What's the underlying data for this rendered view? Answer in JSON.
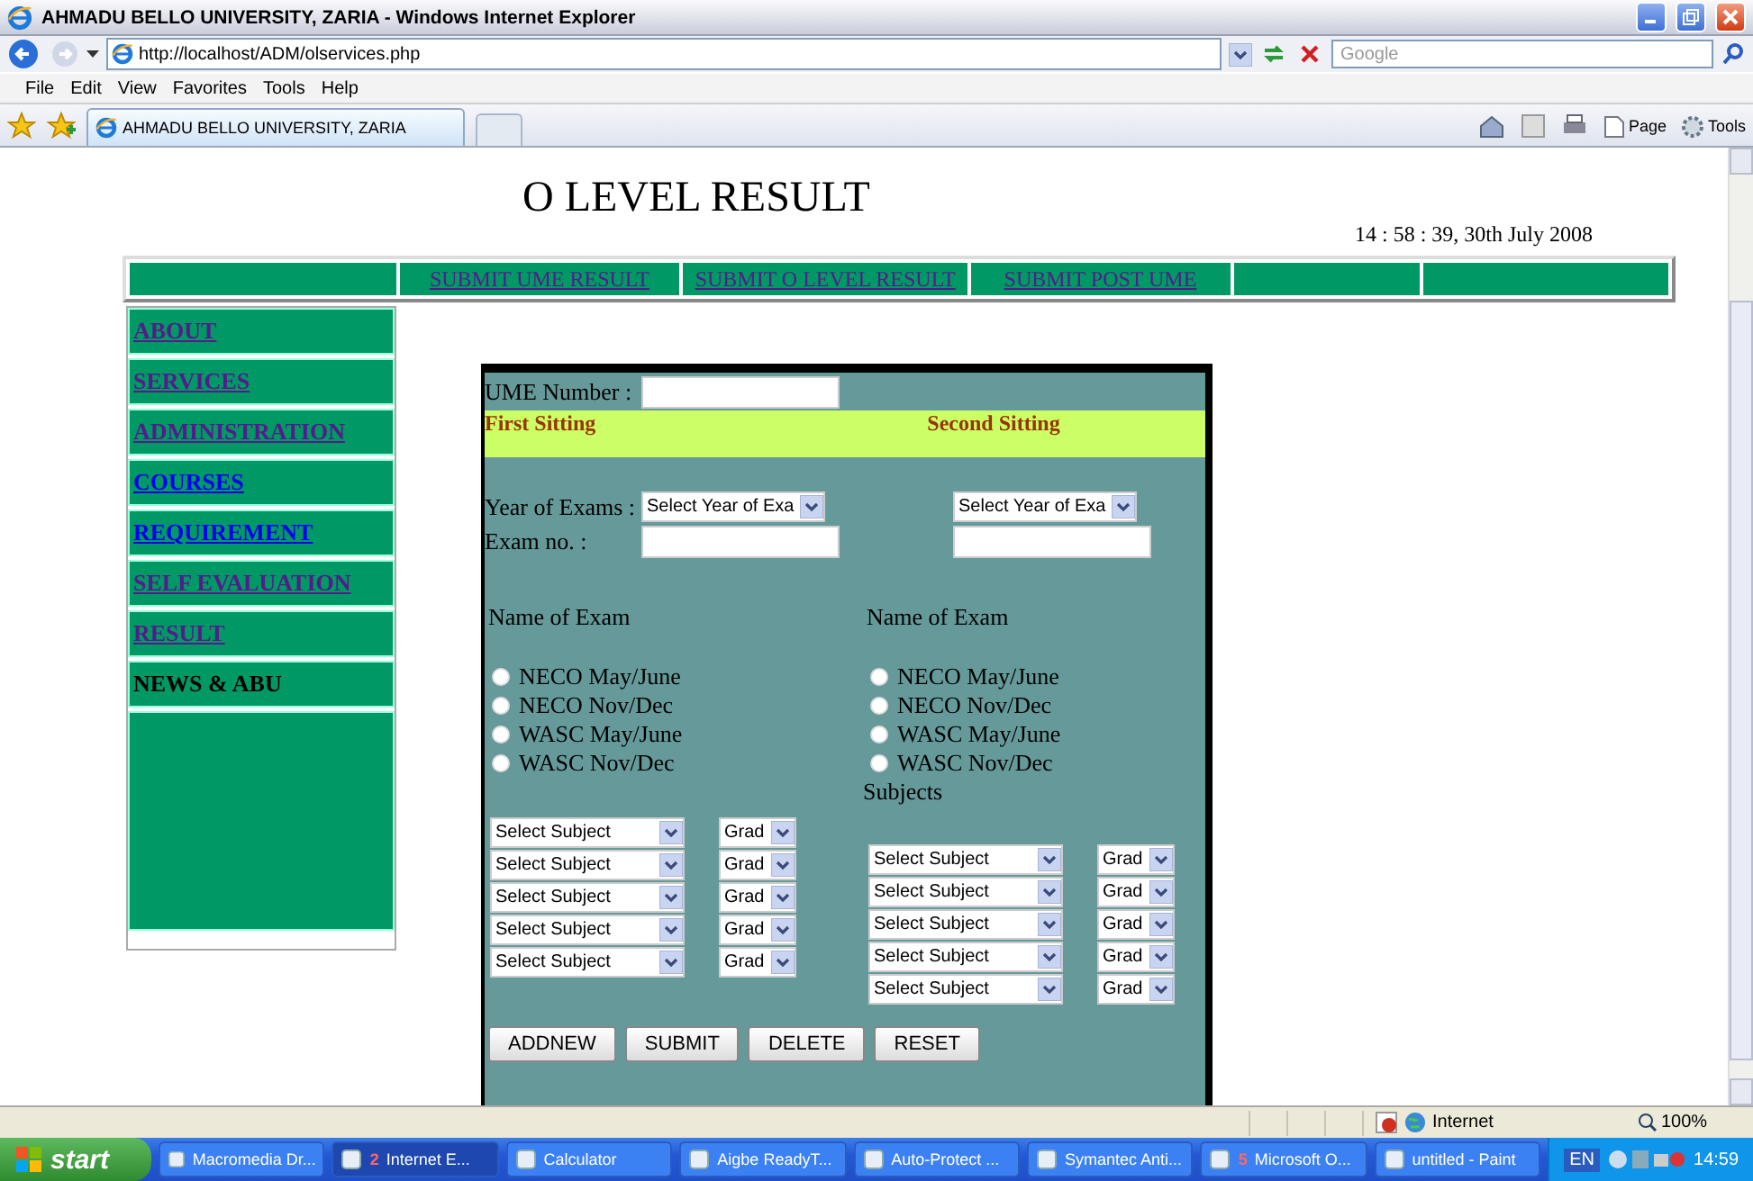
{
  "browser": {
    "title": "AHMADU BELLO UNIVERSITY, ZARIA - Windows Internet Explorer",
    "address": "http://localhost/ADM/olservices.php",
    "search_placeholder": "Google",
    "menu": [
      "File",
      "Edit",
      "View",
      "Favorites",
      "Tools",
      "Help"
    ],
    "tab": "AHMADU BELLO UNIVERSITY, ZARIA",
    "tools": [
      "Page",
      "Tools"
    ]
  },
  "page": {
    "heading": "O LEVEL RESULT",
    "datetime": "14 : 58 : 39, 30th July 2008",
    "nav": [
      {
        "kind": "blank"
      },
      {
        "kind": "link",
        "label": "SUBMIT UME RESULT"
      },
      {
        "kind": "link",
        "label": "SUBMIT O LEVEL RESULT"
      },
      {
        "kind": "link",
        "label": "SUBMIT POST UME"
      },
      {
        "kind": "blank"
      },
      {
        "kind": "blank"
      }
    ],
    "sidebar": [
      {
        "label": "ABOUT",
        "kind": "visited"
      },
      {
        "label": "SERVICES",
        "kind": "visited"
      },
      {
        "label": "ADMINISTRATION",
        "kind": "visited"
      },
      {
        "label": "COURSES",
        "kind": "link"
      },
      {
        "label": "REQUIREMENT",
        "kind": "link"
      },
      {
        "label": "SELF EVALUATION",
        "kind": "visited"
      },
      {
        "label": "RESULT",
        "kind": "visited"
      },
      {
        "label": "NEWS & ABU",
        "kind": "text"
      }
    ]
  },
  "form": {
    "ume_label": "UME Number :",
    "headers": [
      "First Sitting",
      "Second Sitting"
    ],
    "year_label": "Year of Exams :",
    "exam_no_label": "Exam no. :",
    "sittings": [
      {
        "year_select": "Select Year of Exa",
        "name_label": "Name of Exam",
        "exams": [
          {
            "label": "NECO May/June",
            "selected": false
          },
          {
            "label": "NECO Nov/Dec",
            "selected": false
          },
          {
            "label": "WASC May/June",
            "selected": false
          },
          {
            "label": "WASC Nov/Dec",
            "selected": false
          }
        ],
        "subjects": [
          {
            "subject": "Select Subject",
            "grade": "Grad"
          },
          {
            "subject": "Select Subject",
            "grade": "Grad"
          },
          {
            "subject": "Select Subject",
            "grade": "Grad"
          },
          {
            "subject": "Select Subject",
            "grade": "Grad"
          },
          {
            "subject": "Select Subject",
            "grade": "Grad"
          }
        ]
      },
      {
        "year_select": "Select Year of Exa",
        "name_label": "Name of Exam",
        "exams": [
          {
            "label": "NECO May/June",
            "selected": false
          },
          {
            "label": "NECO Nov/Dec",
            "selected": false
          },
          {
            "label": "WASC May/June",
            "selected": false
          },
          {
            "label": "WASC Nov/Dec",
            "selected": false
          }
        ],
        "subjects_label": "Subjects",
        "subjects": [
          {
            "subject": "Select Subject",
            "grade": "Grad"
          },
          {
            "subject": "Select Subject",
            "grade": "Grad"
          },
          {
            "subject": "Select Subject",
            "grade": "Grad"
          },
          {
            "subject": "Select Subject",
            "grade": "Grad"
          },
          {
            "subject": "Select Subject",
            "grade": "Grad"
          }
        ]
      }
    ],
    "buttons": [
      "ADDNEW",
      "SUBMIT",
      "DELETE",
      "RESET"
    ]
  },
  "status": {
    "zone": "Internet",
    "zoom": "100%"
  },
  "taskbar": {
    "start": "start",
    "items": [
      {
        "label": "Macromedia Dr...",
        "selected": false
      },
      {
        "label": "Internet E...",
        "count": "2",
        "selected": true
      },
      {
        "label": "Calculator",
        "selected": false
      },
      {
        "label": "Aigbe ReadyT...",
        "selected": false
      },
      {
        "label": "Auto-Protect ...",
        "selected": false
      },
      {
        "label": "Symantec Anti...",
        "selected": false
      },
      {
        "label": "Microsoft O...",
        "count": "5",
        "selected": false
      },
      {
        "label": "untitled - Paint",
        "selected": false
      }
    ],
    "lang": "EN",
    "clock": "14:59"
  }
}
